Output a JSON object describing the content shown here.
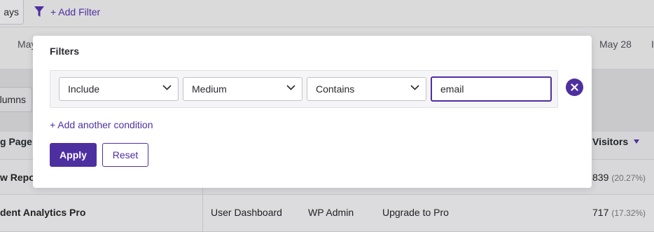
{
  "toolbar": {
    "days_label": "ays",
    "add_filter_label": "+ Add Filter"
  },
  "date_axis": {
    "left_label": "May",
    "right_label": "May 28",
    "edge_label": "I"
  },
  "table": {
    "columns_button": "lumns",
    "headers": {
      "landing_page": "g Page",
      "visitors": "Visitors"
    },
    "rows": [
      {
        "landing_page": "w Repo",
        "visitors": "839",
        "visitors_pct": "(20.27%)"
      },
      {
        "landing_page": "dent Analytics Pro",
        "source": "User Dashboard",
        "medium": "WP Admin",
        "campaign": "Upgrade to Pro",
        "visitors": "717",
        "visitors_pct": "(17.32%)"
      }
    ]
  },
  "filters": {
    "title": "Filters",
    "condition": {
      "mode": "Include",
      "field": "Medium",
      "operator": "Contains",
      "value": "email"
    },
    "add_condition_label": "+ Add another condition",
    "apply_label": "Apply",
    "reset_label": "Reset"
  },
  "colors": {
    "accent": "#4e2fa0",
    "overlay_bg": "#d6d6d8",
    "popover_bg": "#ffffff"
  },
  "icons": {
    "filter": "funnel-icon",
    "dropdown": "chevron-down-icon",
    "remove": "close-circle-icon",
    "sort": "sort-desc-icon"
  }
}
